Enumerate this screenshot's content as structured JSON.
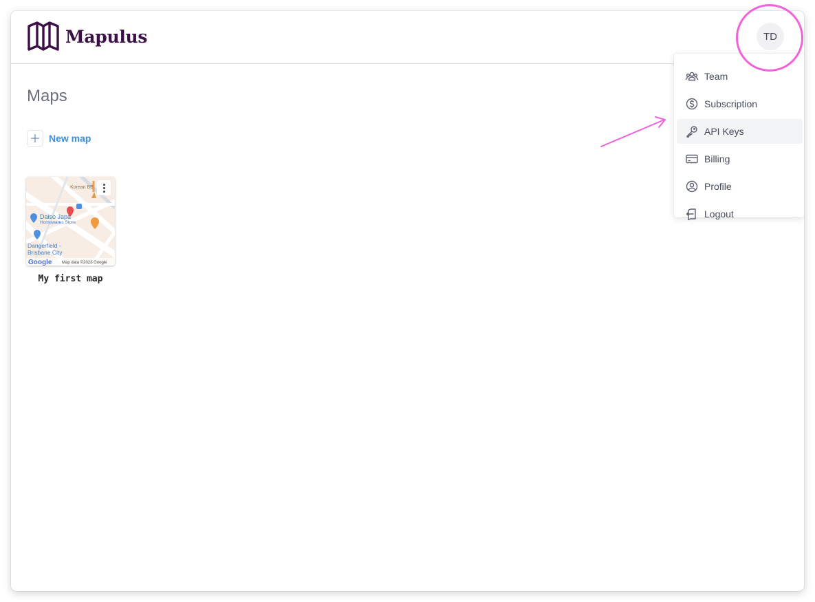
{
  "app": {
    "name": "Mapulus",
    "brand_color": "#3d0f47",
    "accent_color": "#3b8fe0"
  },
  "header": {
    "logo_icon": "folded-map-icon",
    "avatar_initials": "TD"
  },
  "main": {
    "title": "Maps",
    "new_map_label": "New map",
    "maps": [
      {
        "name": "My first map",
        "thumbnail_labels": [
          "Korean BB",
          "Daiso Japa",
          "Homewares Store",
          "Dangerfield -",
          "Brisbane City",
          "Google",
          "Map data ©2023 Google"
        ]
      }
    ]
  },
  "user_menu": {
    "items": [
      {
        "label": "Team",
        "icon": "team-icon"
      },
      {
        "label": "Subscription",
        "icon": "dollar-circle-icon"
      },
      {
        "label": "API Keys",
        "icon": "key-icon",
        "highlighted": true
      },
      {
        "label": "Billing",
        "icon": "credit-card-icon"
      },
      {
        "label": "Profile",
        "icon": "user-circle-icon"
      },
      {
        "label": "Logout",
        "icon": "logout-icon"
      }
    ]
  },
  "annotation_color": "#f062da"
}
